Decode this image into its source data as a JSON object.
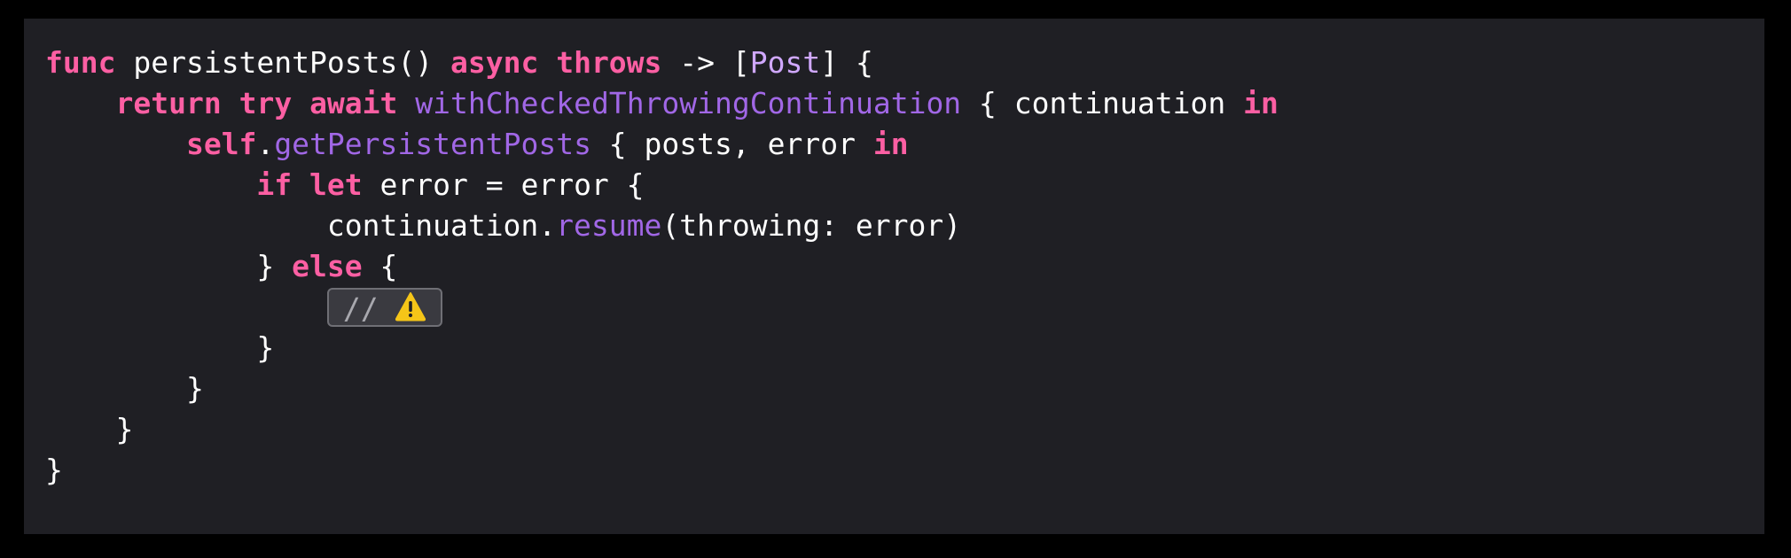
{
  "editor": {
    "lines": [
      {
        "tokens": [
          {
            "t": "func",
            "c": "kw"
          },
          {
            "t": " persistentPosts() ",
            "c": "plain"
          },
          {
            "t": "async",
            "c": "kw"
          },
          {
            "t": " ",
            "c": "plain"
          },
          {
            "t": "throws",
            "c": "kw"
          },
          {
            "t": " -> [",
            "c": "plain"
          },
          {
            "t": "Post",
            "c": "ty"
          },
          {
            "t": "] {",
            "c": "plain"
          }
        ]
      },
      {
        "tokens": [
          {
            "t": "    ",
            "c": "plain"
          },
          {
            "t": "return",
            "c": "kw"
          },
          {
            "t": " ",
            "c": "plain"
          },
          {
            "t": "try",
            "c": "kw"
          },
          {
            "t": " ",
            "c": "plain"
          },
          {
            "t": "await",
            "c": "kw"
          },
          {
            "t": " ",
            "c": "plain"
          },
          {
            "t": "withCheckedThrowingContinuation",
            "c": "fn"
          },
          {
            "t": " { continuation ",
            "c": "plain"
          },
          {
            "t": "in",
            "c": "kw"
          }
        ]
      },
      {
        "tokens": [
          {
            "t": "        ",
            "c": "plain"
          },
          {
            "t": "self",
            "c": "kw"
          },
          {
            "t": ".",
            "c": "plain"
          },
          {
            "t": "getPersistentPosts",
            "c": "fn"
          },
          {
            "t": " { posts, error ",
            "c": "plain"
          },
          {
            "t": "in",
            "c": "kw"
          }
        ]
      },
      {
        "tokens": [
          {
            "t": "            ",
            "c": "plain"
          },
          {
            "t": "if",
            "c": "kw"
          },
          {
            "t": " ",
            "c": "plain"
          },
          {
            "t": "let",
            "c": "kw"
          },
          {
            "t": " error = error {",
            "c": "plain"
          }
        ]
      },
      {
        "tokens": [
          {
            "t": "                continuation.",
            "c": "plain"
          },
          {
            "t": "resume",
            "c": "fn"
          },
          {
            "t": "(throwing: error)",
            "c": "plain"
          }
        ]
      },
      {
        "tokens": [
          {
            "t": "            } ",
            "c": "plain"
          },
          {
            "t": "else",
            "c": "kw"
          },
          {
            "t": " {",
            "c": "plain"
          }
        ]
      },
      {
        "placeholder": true,
        "indent": "                ",
        "placeholder_text": "//",
        "placeholder_icon": "warning-icon"
      },
      {
        "tokens": [
          {
            "t": "            }",
            "c": "plain"
          }
        ]
      },
      {
        "tokens": [
          {
            "t": "        }",
            "c": "plain"
          }
        ]
      },
      {
        "tokens": [
          {
            "t": "    }",
            "c": "plain"
          }
        ]
      },
      {
        "tokens": [
          {
            "t": "}",
            "c": "plain"
          }
        ]
      }
    ]
  },
  "colors": {
    "background": "#1f1f24",
    "keyword": "#fc5fa3",
    "function": "#a167e6",
    "type": "#d0a8ff",
    "plain": "#ffffff",
    "warning": "#f5c518"
  }
}
